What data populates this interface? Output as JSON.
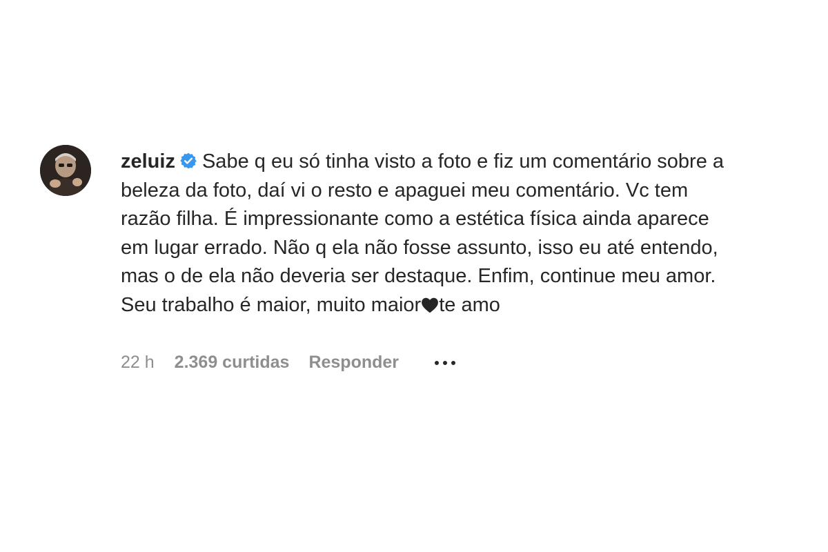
{
  "comment": {
    "username": "zeluiz",
    "verified": true,
    "text": "Sabe q eu só tinha visto a foto e fiz um comentário sobre a beleza da foto, daí vi o resto e apaguei meu comentário. Vc tem razão filha. É impressionante como a estética física ainda aparece em lugar errado. Não q ela não fosse assunto, isso eu até entendo, mas o de ela não deveria ser destaque. Enfim, continue meu amor. Seu trabalho é maior, muito maior",
    "text_after_heart": "te amo",
    "time": "22 h",
    "likes": "2.369 curtidas",
    "reply_label": "Responder"
  },
  "icons": {
    "verified": "verified-badge-icon",
    "heart": "black-heart-icon",
    "more": "more-options-icon"
  },
  "colors": {
    "verified_blue": "#3897f0",
    "text": "#262626",
    "meta": "#8e8e8e"
  }
}
